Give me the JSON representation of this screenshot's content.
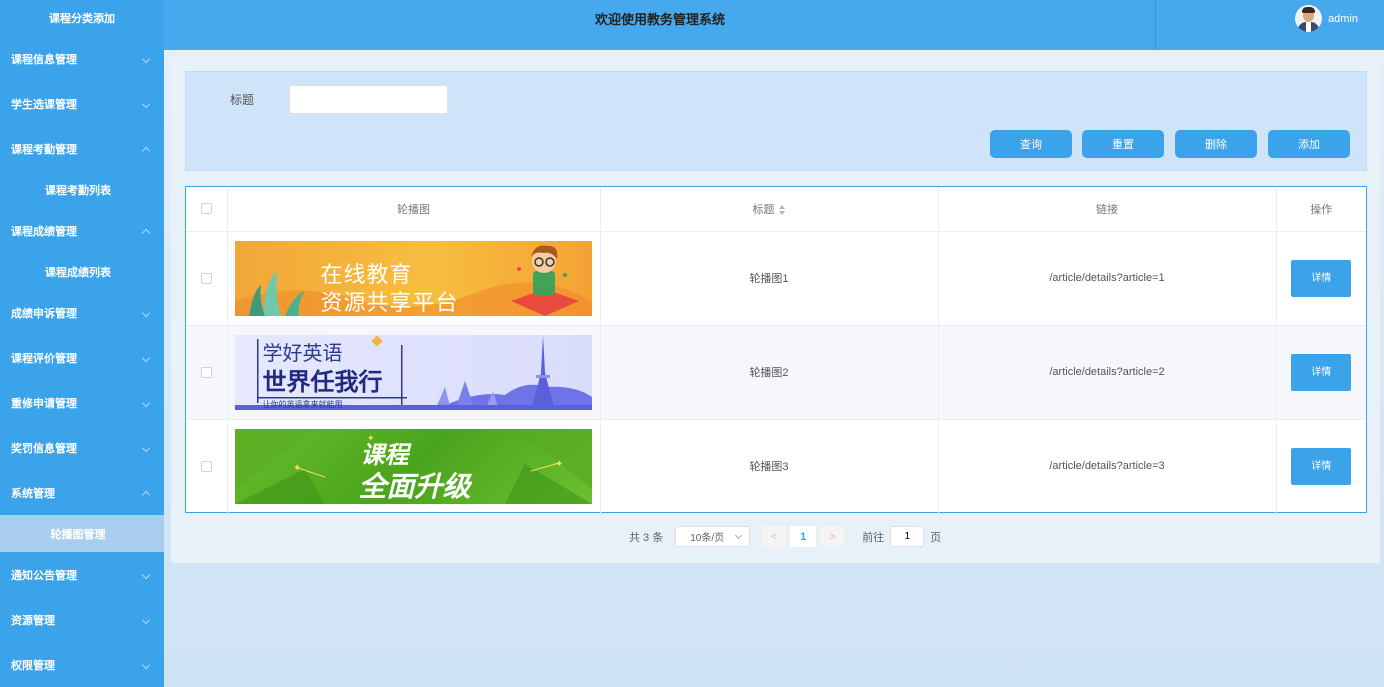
{
  "sidebar": {
    "header": "课程分类添加",
    "menus": [
      {
        "label": "课程信息管理"
      },
      {
        "label": "学生选课管理"
      },
      {
        "label": "课程考勤管理",
        "sub": "课程考勤列表"
      },
      {
        "label": "课程成绩管理",
        "sub": "课程成绩列表"
      },
      {
        "label": "成绩申诉管理"
      },
      {
        "label": "课程评价管理"
      },
      {
        "label": "重修申请管理"
      },
      {
        "label": "奖罚信息管理"
      },
      {
        "label": "系统管理",
        "sub": "轮播图管理"
      },
      {
        "label": "通知公告管理"
      },
      {
        "label": "资源管理"
      },
      {
        "label": "权限管理"
      }
    ]
  },
  "header": {
    "title": "欢迎使用教务管理系统",
    "username": "admin"
  },
  "search": {
    "label": "标题",
    "value": "",
    "buttons": {
      "query": "查询",
      "reset": "重置",
      "delete": "删除",
      "add": "添加"
    }
  },
  "table": {
    "columns": {
      "image": "轮播图",
      "title": "标题",
      "link": "链接",
      "action": "操作"
    },
    "rows": [
      {
        "banner_line1": "在线教育",
        "banner_line2": "资源共享平台",
        "title": "轮播图1",
        "link": "/article/details?article=1",
        "action": "详情"
      },
      {
        "banner_line1": "学好英语",
        "banner_line2": "世界任我行",
        "banner_line3": "让你的英语拿来就能用",
        "title": "轮播图2",
        "link": "/article/details?article=2",
        "action": "详情"
      },
      {
        "banner_line1": "课程",
        "banner_line2": "全面升级",
        "title": "轮播图3",
        "link": "/article/details?article=3",
        "action": "详情"
      }
    ]
  },
  "pagination": {
    "total": "共 3 条",
    "page_size": "10条/页",
    "prev": "<",
    "current": "1",
    "next": ">",
    "goto_prefix": "前往",
    "goto_value": "1",
    "goto_suffix": "页"
  },
  "colors": {
    "primary": "#3ba3ea",
    "sidebar": "#3ba3ea",
    "active_menu": "#a9cdee"
  }
}
